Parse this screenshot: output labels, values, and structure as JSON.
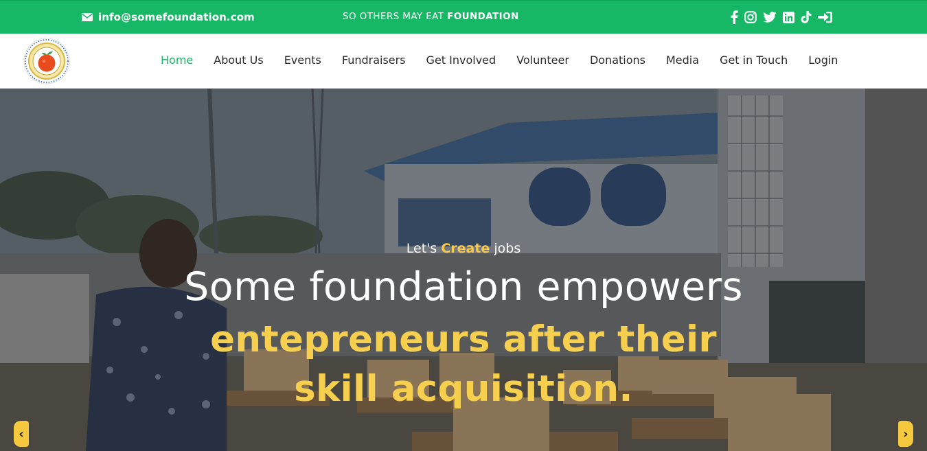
{
  "topbar": {
    "email": "info@somefoundation.com",
    "tagline_prefix": "SO OTHERS MAY EAT ",
    "tagline_bold": "FOUNDATION",
    "socials": [
      "facebook-icon",
      "instagram-icon",
      "twitter-icon",
      "linkedin-icon",
      "tiktok-icon",
      "login-icon"
    ],
    "background": "#16b865"
  },
  "nav": {
    "items": [
      {
        "label": "Home",
        "active": true
      },
      {
        "label": "About Us"
      },
      {
        "label": "Events"
      },
      {
        "label": "Fundraisers"
      },
      {
        "label": "Get Involved"
      },
      {
        "label": "Volunteer"
      },
      {
        "label": "Donations"
      },
      {
        "label": "Media"
      },
      {
        "label": "Get in Touch"
      },
      {
        "label": "Login"
      }
    ],
    "active_color": "#16b865"
  },
  "hero": {
    "kicker_prefix": "Let's ",
    "kicker_highlight": "Create",
    "kicker_suffix": " jobs",
    "headline": "Some foundation empowers",
    "highlight": "entepreneurs after their skill acquisition.",
    "highlight_color": "#f6cf4e",
    "prev_label": "‹",
    "next_label": "›"
  }
}
